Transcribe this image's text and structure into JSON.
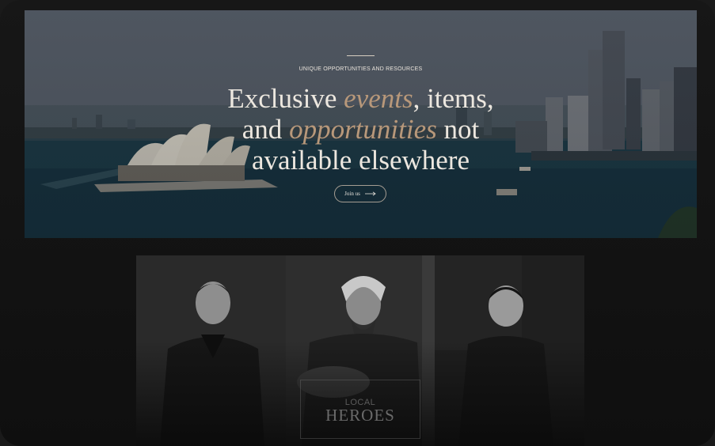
{
  "hero": {
    "kicker": "UNIQUE OPPORTUNITIES AND RESOURCES",
    "title": {
      "line1_a": "Exclusive ",
      "line1_accent": "events",
      "line1_b": ", items,",
      "line2_a": "and ",
      "line2_accent": "opportunities",
      "line2_b": " not",
      "line3": "available elsewhere"
    },
    "join_label": "Join us",
    "arrow_icon": "arrow-right-icon",
    "accent_color": "#b8987a"
  },
  "people": {
    "badge_small": "LOCAL",
    "badge_big": "HEROES"
  }
}
